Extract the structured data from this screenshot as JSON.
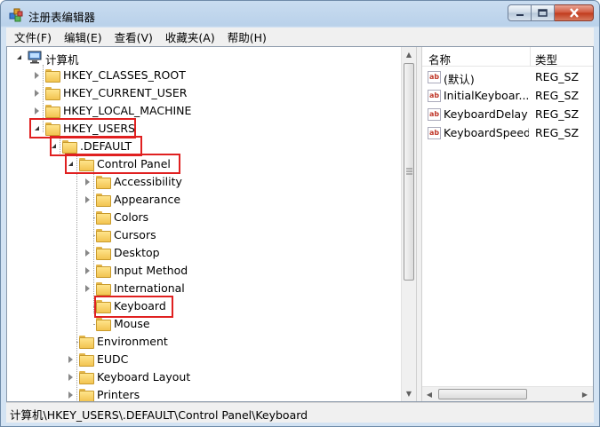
{
  "window": {
    "title": "注册表编辑器"
  },
  "menu": [
    "文件(F)",
    "编辑(E)",
    "查看(V)",
    "收藏夹(A)",
    "帮助(H)"
  ],
  "tree": {
    "root": "计算机",
    "hives": [
      "HKEY_CLASSES_ROOT",
      "HKEY_CURRENT_USER",
      "HKEY_LOCAL_MACHINE",
      "HKEY_USERS"
    ],
    "default": ".DEFAULT",
    "control_panel": "Control Panel",
    "cp_children": [
      "Accessibility",
      "Appearance",
      "Colors",
      "Cursors",
      "Desktop",
      "Input Method",
      "International",
      "Keyboard",
      "Mouse"
    ],
    "default_children": [
      "Environment",
      "EUDC",
      "Keyboard Layout",
      "Printers"
    ]
  },
  "list": {
    "columns": [
      "名称",
      "类型"
    ],
    "rows": [
      {
        "name": "(默认)",
        "type": "REG_SZ"
      },
      {
        "name": "InitialKeyboar...",
        "type": "REG_SZ"
      },
      {
        "name": "KeyboardDelay",
        "type": "REG_SZ"
      },
      {
        "name": "KeyboardSpeed",
        "type": "REG_SZ"
      }
    ],
    "value_icon_text": "ab"
  },
  "status": {
    "path": "计算机\\HKEY_USERS\\.DEFAULT\\Control Panel\\Keyboard"
  },
  "colors": {
    "highlight": "#e02020",
    "folder": "#f2c451"
  }
}
